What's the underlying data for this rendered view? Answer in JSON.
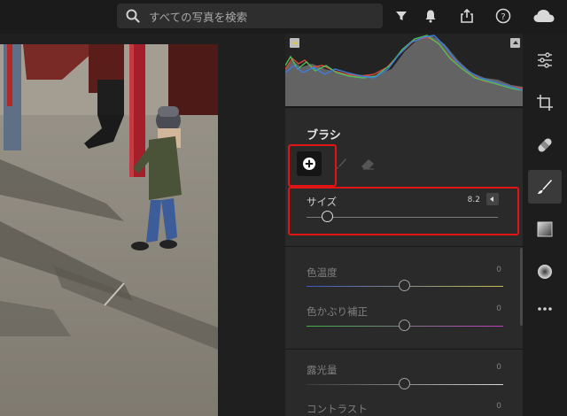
{
  "search": {
    "placeholder": "すべての写真を検索"
  },
  "top_icons": [
    "filter-icon",
    "bell-icon",
    "share-icon",
    "help-icon",
    "cloud-icon"
  ],
  "histogram": {
    "colors": {
      "red": "#d94a3c",
      "green": "#4fbf5a",
      "blue": "#3d7ddb"
    }
  },
  "brush_panel": {
    "title": "ブラシ",
    "tools": [
      "add-brush-icon",
      "brush-icon",
      "eraser-icon"
    ],
    "size": {
      "label": "サイズ",
      "value": "8.2",
      "fraction": 0.11
    }
  },
  "sliders": [
    {
      "key": "temp",
      "label": "色温度",
      "value": "0",
      "gradient": [
        "#3b56c4",
        "#c9c14a"
      ],
      "fraction": 0.5
    },
    {
      "key": "tint",
      "label": "色かぶり補正",
      "value": "0",
      "gradient": [
        "#3fb14a",
        "#c03fc0"
      ],
      "fraction": 0.5
    },
    {
      "key": "exposure",
      "label": "露光量",
      "value": "0",
      "gradient": [
        "#3a3a3a",
        "#d8d8d8"
      ],
      "fraction": 0.5
    },
    {
      "key": "contrast",
      "label": "コントラスト",
      "value": "0",
      "gradient": [
        "#3a3a3a",
        "#d8d8d8"
      ],
      "fraction": 0.5
    }
  ],
  "right_rail": [
    "adjust-sliders-icon",
    "crop-icon",
    "healing-bandage-icon",
    "brush-icon",
    "linear-gradient-icon",
    "radial-gradient-icon",
    "more-icon"
  ],
  "accent_colors": {
    "highlight": "#e01414"
  }
}
